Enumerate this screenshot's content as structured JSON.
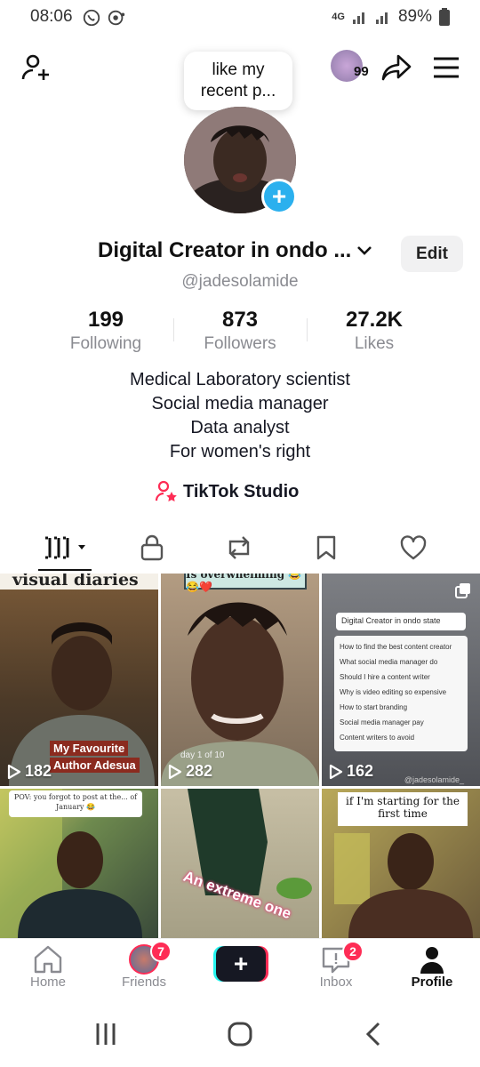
{
  "status_bar": {
    "time": "08:06",
    "network": "4G",
    "battery": "89%"
  },
  "header": {
    "left_icon": "add-friend-icon",
    "bubble_text": "like my recent p...",
    "friend_badge": "99",
    "share_icon": "share-icon",
    "menu_icon": "menu-icon"
  },
  "profile": {
    "name": "Digital Creator in ondo ...",
    "edit_label": "Edit",
    "handle": "@jadesolamide",
    "stats": [
      {
        "value": "199",
        "label": "Following"
      },
      {
        "value": "873",
        "label": "Followers"
      },
      {
        "value": "27.2K",
        "label": "Likes"
      }
    ],
    "bio": [
      "Medical Laboratory scientist",
      "Social media manager",
      "Data analyst",
      "For women's right"
    ],
    "studio_label": "TikTok Studio"
  },
  "tabs": [
    "videos-grid-icon",
    "lock-icon",
    "repost-icon",
    "bookmark-icon",
    "heart-icon"
  ],
  "videos": [
    {
      "views": "182",
      "caption_top": "visual diaries",
      "caption_mid": "My Favourite",
      "caption_bottom": "Author Adesua"
    },
    {
      "views": "282",
      "caption_top": "Is overwhelming 😂😂❤️",
      "caption_small": "day 1 of 10"
    },
    {
      "views": "162",
      "search_title": "Digital Creator in ondo state",
      "search_items": [
        "How to find the best content creator",
        "What social media manager do",
        "Should I hire a content writer",
        "Why is video editing so expensive",
        "How to start branding",
        "Social media manager pay",
        "Content writers to avoid"
      ],
      "watermark": "@jadesolamide_"
    },
    {
      "caption_top": "POV: you forgot to post at the... of January 😂"
    },
    {
      "caption_mid": "An extreme one"
    },
    {
      "caption_top": "if I'm starting for the first time"
    }
  ],
  "bottom_nav": {
    "items": [
      {
        "label": "Home"
      },
      {
        "label": "Friends",
        "badge": "7"
      },
      {
        "label": "+"
      },
      {
        "label": "Inbox",
        "badge": "2"
      },
      {
        "label": "Profile"
      }
    ]
  },
  "colors": {
    "accent_blue": "#2bb0ee",
    "tiktok_red": "#fe2c55",
    "tiktok_cyan": "#25f4ee"
  }
}
